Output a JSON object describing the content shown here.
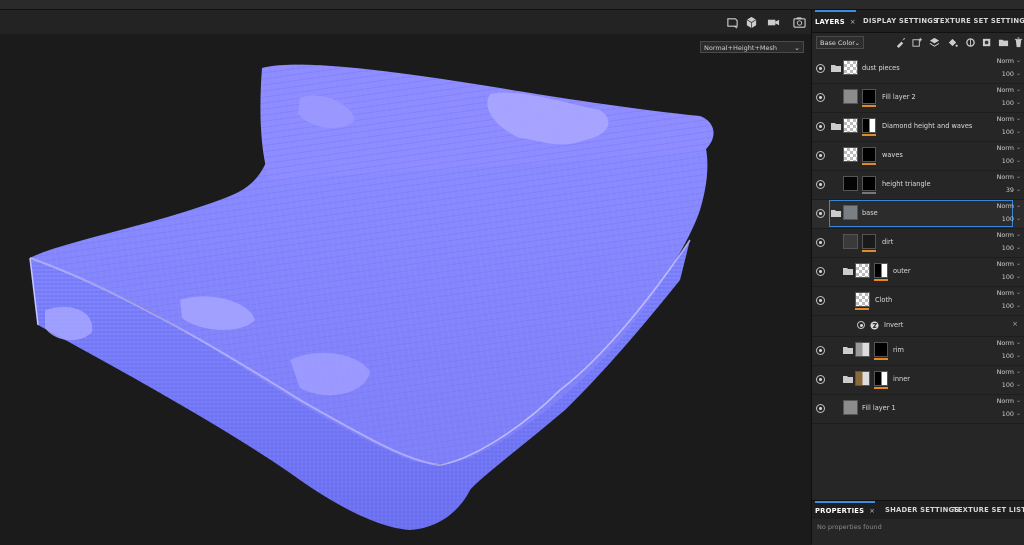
{
  "viewport": {
    "mode_select": "Normal+Height+Mesh",
    "toolbar_icons": [
      "frame-view-icon",
      "cube-view-icon",
      "camera-icon",
      "screenshot-icon"
    ],
    "mesh_colors": {
      "base": "#8080ff",
      "highlight": "#a4a2ff",
      "shadow": "#5c64e8"
    }
  },
  "layers_panel": {
    "tabs": [
      "LAYERS",
      "DISPLAY SETTINGS",
      "TEXTURE SET SETTINGS"
    ],
    "tab_close": "×",
    "channel_select": "Base Color",
    "toolbar_icons": [
      "paint-brush-icon",
      "add-fill-layer-icon",
      "add-layer-icon",
      "paint-bucket-icon",
      "add-effect-icon",
      "add-mask-icon",
      "add-folder-icon",
      "delete-icon"
    ],
    "layers": [
      {
        "name": "dust pieces",
        "blend": "Norm",
        "opacity": "100"
      },
      {
        "name": "Fill layer 2",
        "blend": "Norm",
        "opacity": "100"
      },
      {
        "name": "Diamond height and waves",
        "blend": "Norm",
        "opacity": "100"
      },
      {
        "name": "waves",
        "blend": "Norm",
        "opacity": "100"
      },
      {
        "name": "height triangle",
        "blend": "Norm",
        "opacity": "39"
      },
      {
        "name": "base",
        "blend": "Norm",
        "opacity": "100"
      },
      {
        "name": "dirt",
        "blend": "Norm",
        "opacity": "100"
      },
      {
        "name": "outer",
        "blend": "Norm",
        "opacity": "100"
      },
      {
        "name": "Cloth",
        "blend": "Norm",
        "opacity": "100"
      },
      {
        "name": "Invert",
        "close": "×"
      },
      {
        "name": "rim",
        "blend": "Norm",
        "opacity": "100"
      },
      {
        "name": "inner",
        "blend": "Norm",
        "opacity": "100"
      },
      {
        "name": "Fill layer 1",
        "blend": "Norm",
        "opacity": "100"
      }
    ]
  },
  "properties_panel": {
    "tabs": [
      "PROPERTIES",
      "SHADER SETTINGS",
      "TEXTURE SET LIST"
    ],
    "tab_close": "×",
    "empty_text": "No properties found"
  },
  "accent_color": "#3a86d6",
  "mask_bar_color": "#e08a2a"
}
